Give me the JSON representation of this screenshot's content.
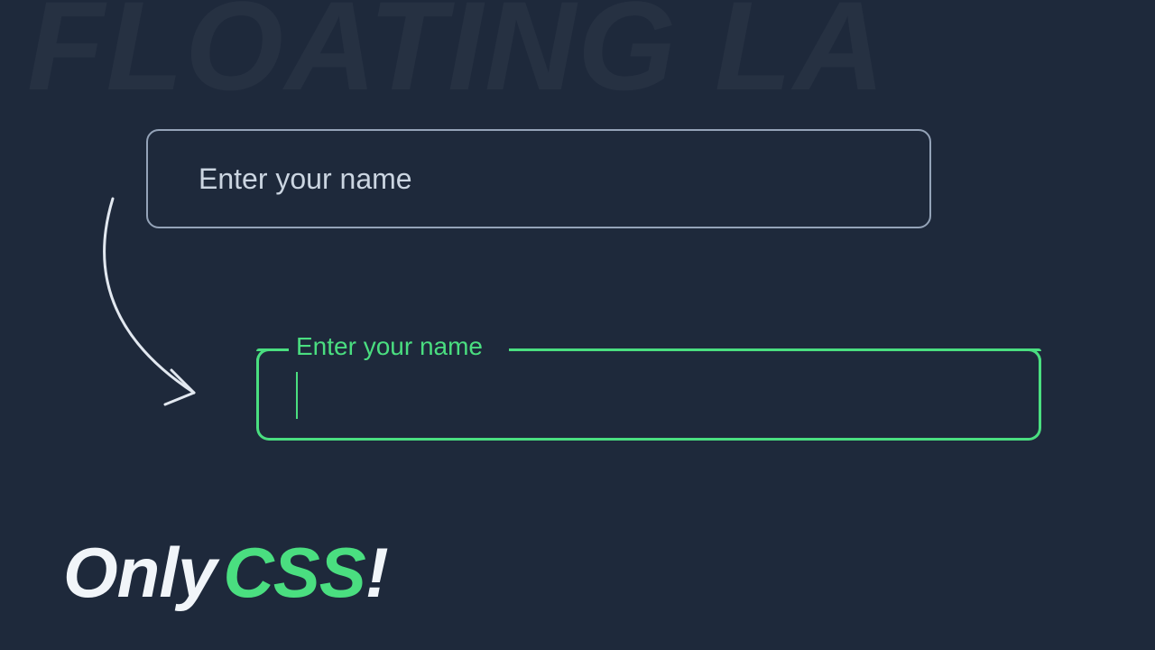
{
  "background_text": "FLOATING LA",
  "input_default": {
    "placeholder": "Enter your name"
  },
  "input_focused": {
    "label": "Enter your name"
  },
  "tagline": {
    "word1": "Only",
    "word2": "CSS",
    "word3": "!"
  },
  "colors": {
    "background": "#1e293b",
    "accent": "#4ade80",
    "border_default": "#94a3b8",
    "text_light": "#f1f5f9"
  }
}
